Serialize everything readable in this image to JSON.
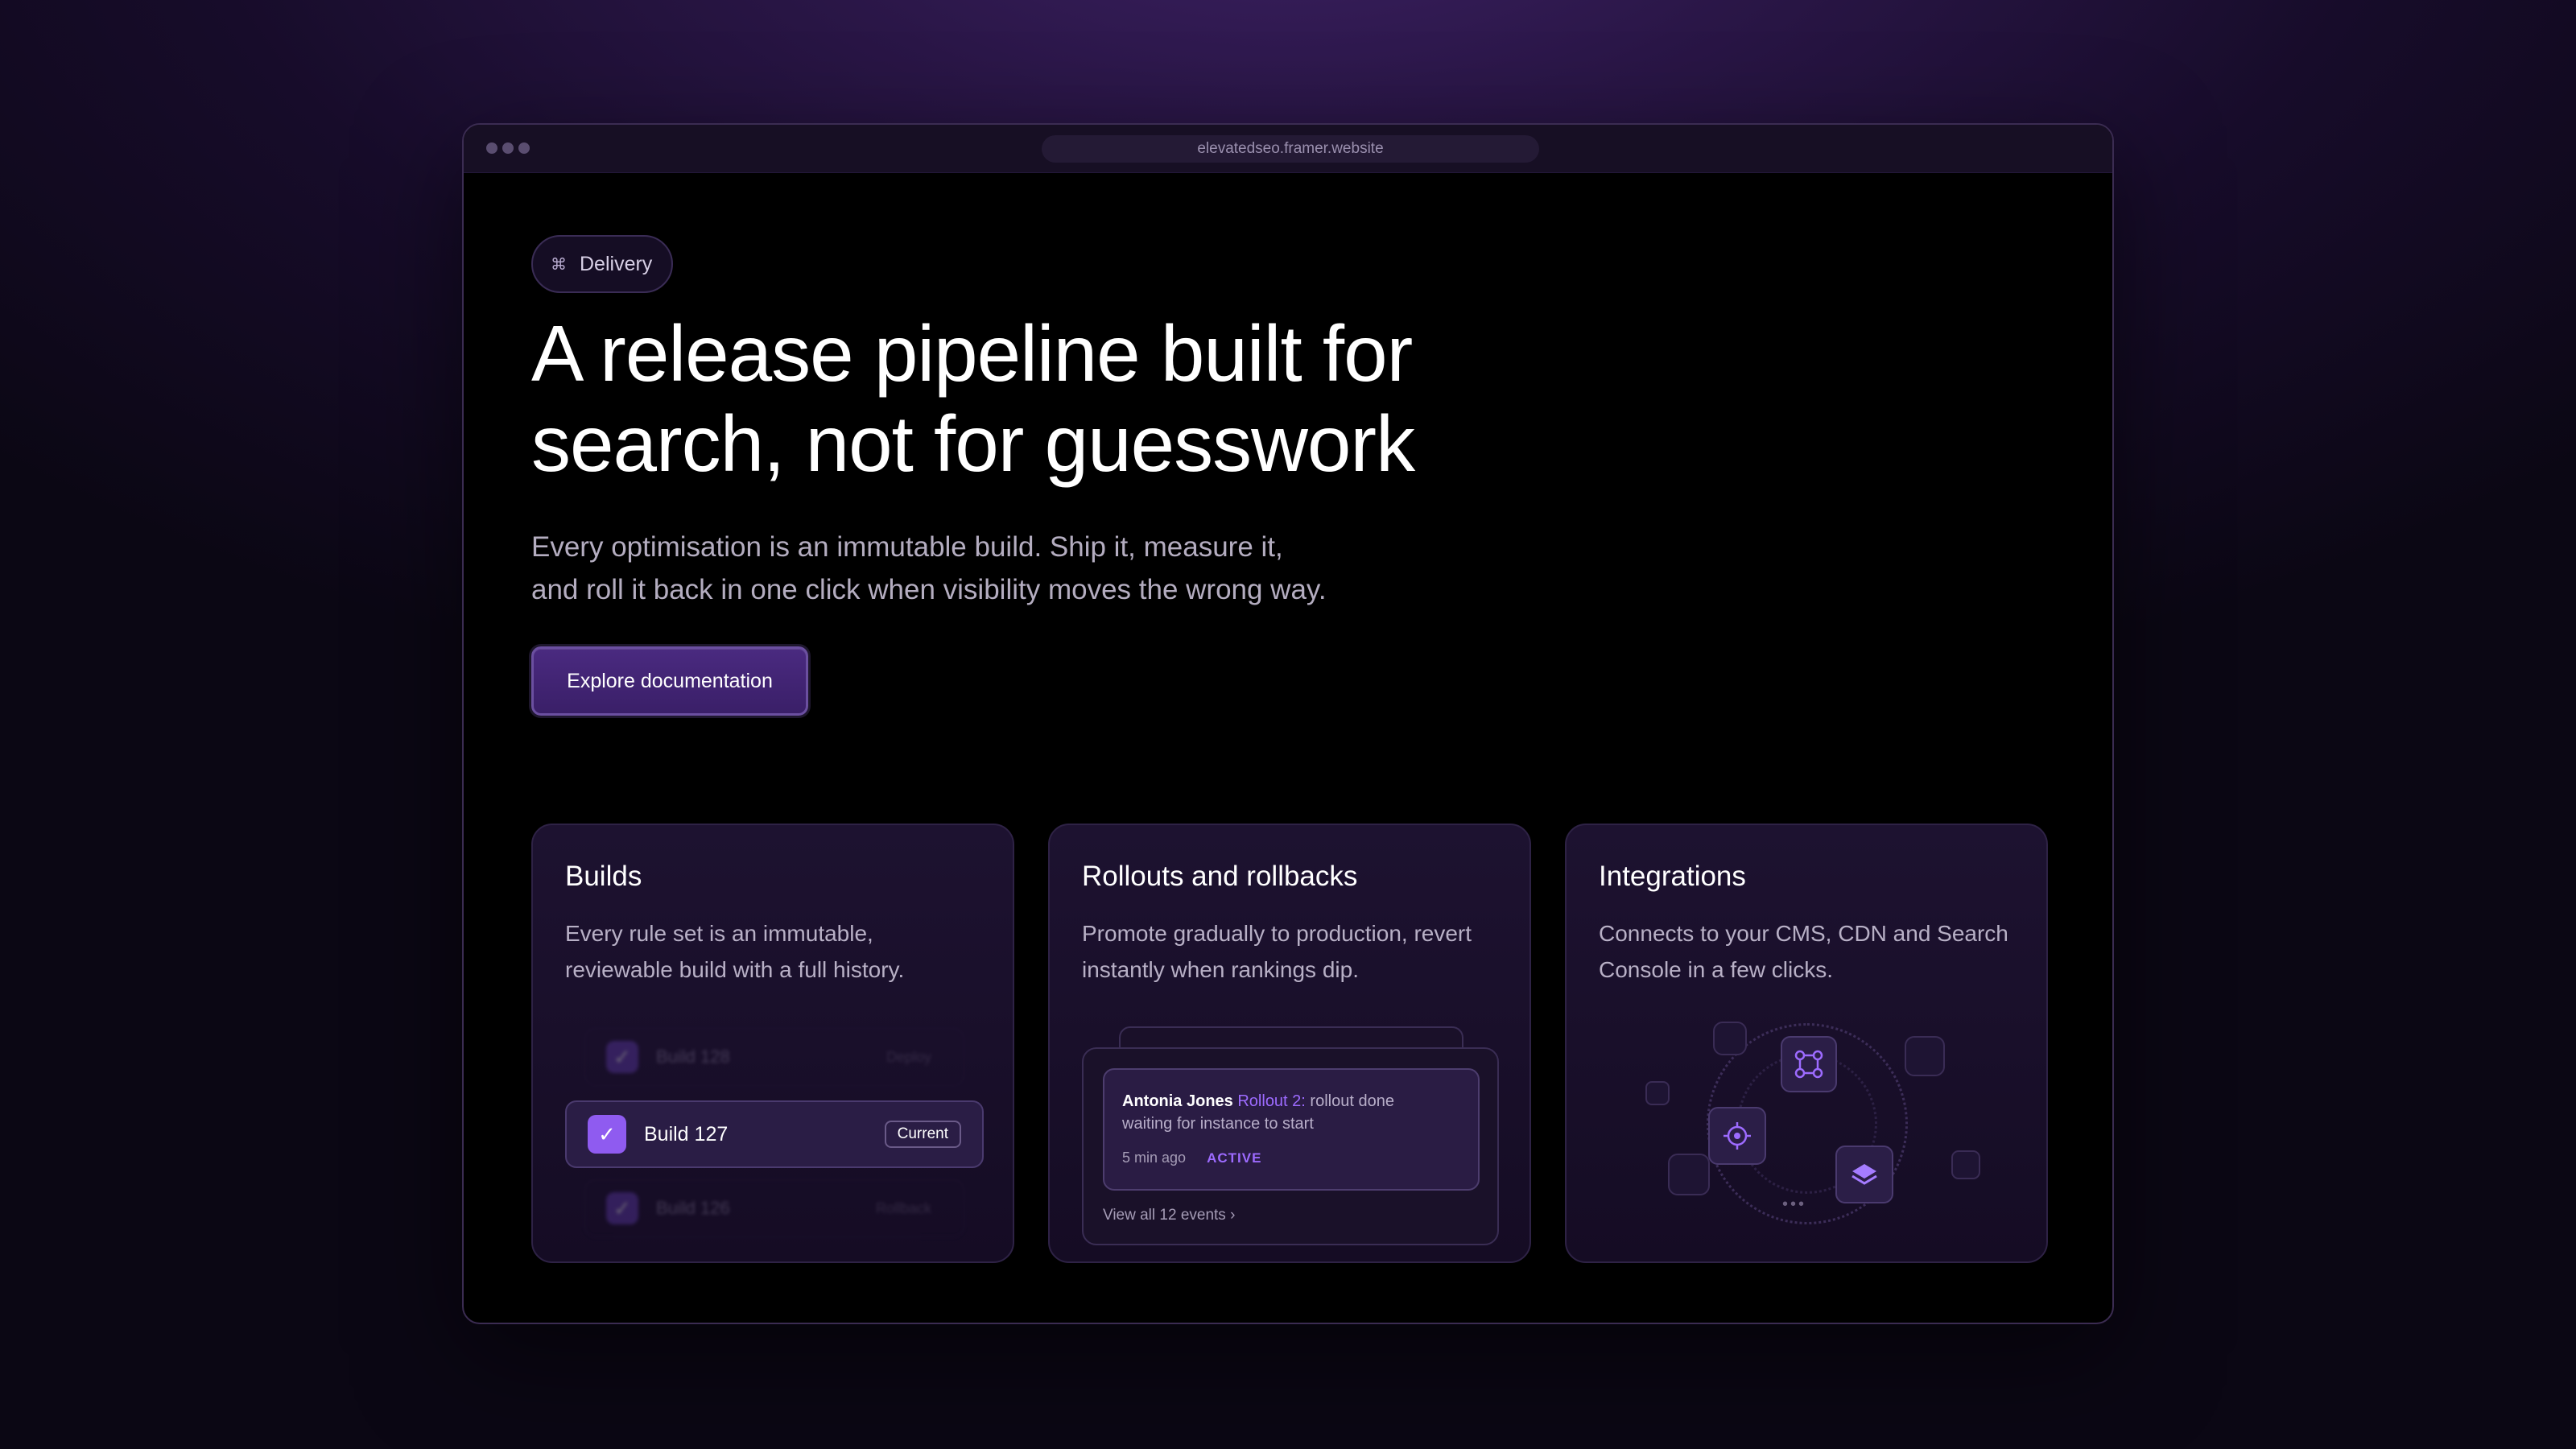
{
  "browser": {
    "url": "elevatedseo.framer.website"
  },
  "hero": {
    "badge": "Delivery",
    "headline_line1": "A release pipeline built for",
    "headline_line2": "search, not for guesswork",
    "sub_line1": "Every optimisation is an immutable build. Ship it, measure it,",
    "sub_line2": "and roll it back in one click when visibility moves the wrong way.",
    "cta": "Explore documentation"
  },
  "cards": {
    "builds": {
      "title": "Builds",
      "desc": "Every rule set is an immutable, reviewable build with a full history.",
      "rows": [
        {
          "label": "Build 128",
          "tag": "Deploy"
        },
        {
          "label": "Build 127",
          "tag": "Current"
        },
        {
          "label": "Build 126",
          "tag": "Rollback"
        }
      ]
    },
    "rollouts": {
      "title": "Rollouts and rollbacks",
      "desc": "Promote gradually to production, revert instantly when rankings dip.",
      "event": {
        "name": "Antonia Jones",
        "accent": "Rollout 2:",
        "text": " rollout done",
        "line2": "waiting for instance to start",
        "time": "5 min ago",
        "status": "ACTIVE"
      },
      "view_all": "View all 12 events ›"
    },
    "integrations": {
      "title": "Integrations",
      "desc": "Connects to your CMS, CDN and Search Console in a few clicks."
    }
  },
  "colors": {
    "accent": "#9d6bff",
    "cta": "#3a1f68"
  }
}
